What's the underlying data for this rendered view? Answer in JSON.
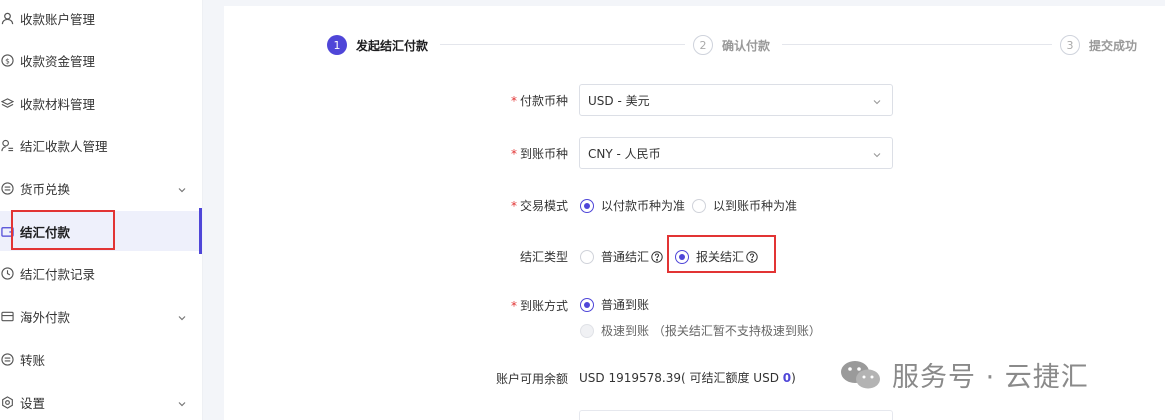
{
  "sidebar": {
    "items": [
      {
        "label": "收款账户管理",
        "icon": "user-icon"
      },
      {
        "label": "收款资金管理",
        "icon": "dollar-circle-icon"
      },
      {
        "label": "收款材料管理",
        "icon": "layers-icon"
      },
      {
        "label": "结汇收款人管理",
        "icon": "user-list-icon"
      },
      {
        "label": "货币兑换",
        "icon": "exchange-icon"
      },
      {
        "label": "结汇付款",
        "icon": "wallet-icon"
      },
      {
        "label": "结汇付款记录",
        "icon": "clock-icon"
      },
      {
        "label": "海外付款",
        "icon": "card-icon"
      },
      {
        "label": "转账",
        "icon": "transfer-icon"
      },
      {
        "label": "设置",
        "icon": "gear-icon"
      }
    ],
    "active_item": "结汇付款"
  },
  "steps": [
    {
      "num": "1",
      "label": "发起结汇付款",
      "state": "current"
    },
    {
      "num": "2",
      "label": "确认付款",
      "state": "pending"
    },
    {
      "num": "3",
      "label": "提交成功",
      "state": "pending"
    }
  ],
  "form": {
    "pay_currency": {
      "label": "付款币种",
      "value": "USD - 美元"
    },
    "receive_currency": {
      "label": "到账币种",
      "value": "CNY - 人民币"
    },
    "trade_mode": {
      "label": "交易模式",
      "options": [
        "以付款币种为准",
        "以到账币种为准"
      ],
      "selected": "以付款币种为准"
    },
    "settle_type": {
      "label": "结汇类型",
      "options": [
        "普通结汇",
        "报关结汇"
      ],
      "selected": "报关结汇"
    },
    "arrival_mode": {
      "label": "到账方式",
      "options": [
        "普通到账",
        "极速到账 （报关结汇暂不支持极速到账）"
      ],
      "selected": "普通到账"
    },
    "balance": {
      "label": "账户可用余额",
      "text_prefix": "USD 1919578.39( 可结汇额度 USD ",
      "amount": "0",
      "text_suffix": ")"
    }
  },
  "watermark": {
    "text": "服务号 · 云捷汇"
  },
  "colors": {
    "accent": "#4f46d8",
    "highlight": "#e23434",
    "required": "#e23434"
  }
}
